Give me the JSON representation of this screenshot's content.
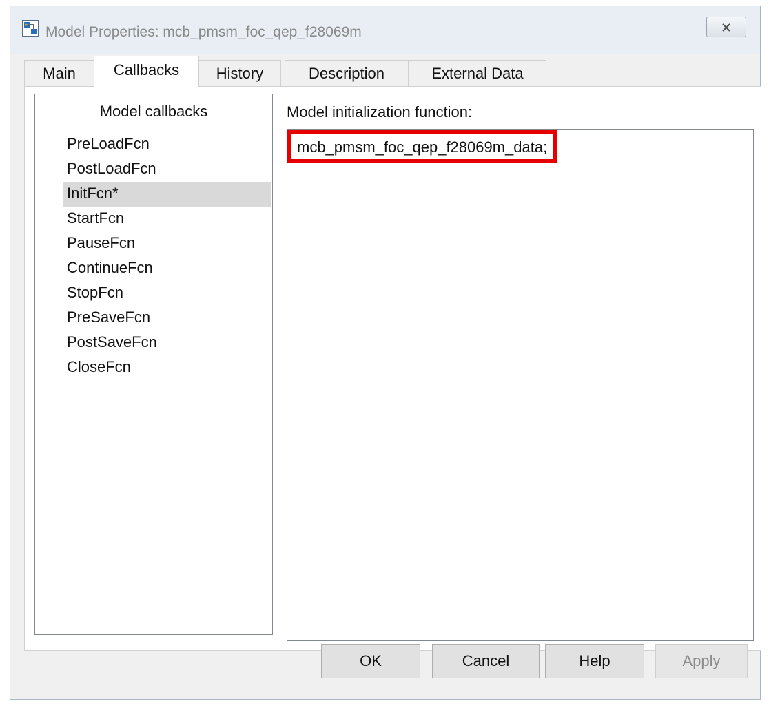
{
  "window": {
    "title": "Model Properties: mcb_pmsm_foc_qep_f28069m"
  },
  "tabs": [
    {
      "label": "Main"
    },
    {
      "label": "Callbacks"
    },
    {
      "label": "History"
    },
    {
      "label": "Description"
    },
    {
      "label": "External Data"
    }
  ],
  "active_tab": "Callbacks",
  "callbacks": {
    "header": "Model callbacks",
    "items": [
      {
        "label": "PreLoadFcn"
      },
      {
        "label": "PostLoadFcn"
      },
      {
        "label": "InitFcn*"
      },
      {
        "label": "StartFcn"
      },
      {
        "label": "PauseFcn"
      },
      {
        "label": "ContinueFcn"
      },
      {
        "label": "StopFcn"
      },
      {
        "label": "PreSaveFcn"
      },
      {
        "label": "PostSaveFcn"
      },
      {
        "label": "CloseFcn"
      }
    ],
    "selected": "InitFcn*"
  },
  "editor": {
    "label": "Model initialization function:",
    "value": "mcb_pmsm_foc_qep_f28069m_data;"
  },
  "buttons": {
    "ok": "OK",
    "cancel": "Cancel",
    "help": "Help",
    "apply": "Apply"
  },
  "colors": {
    "highlight_border": "#e60000",
    "selected_row": "#d9d9d9"
  }
}
